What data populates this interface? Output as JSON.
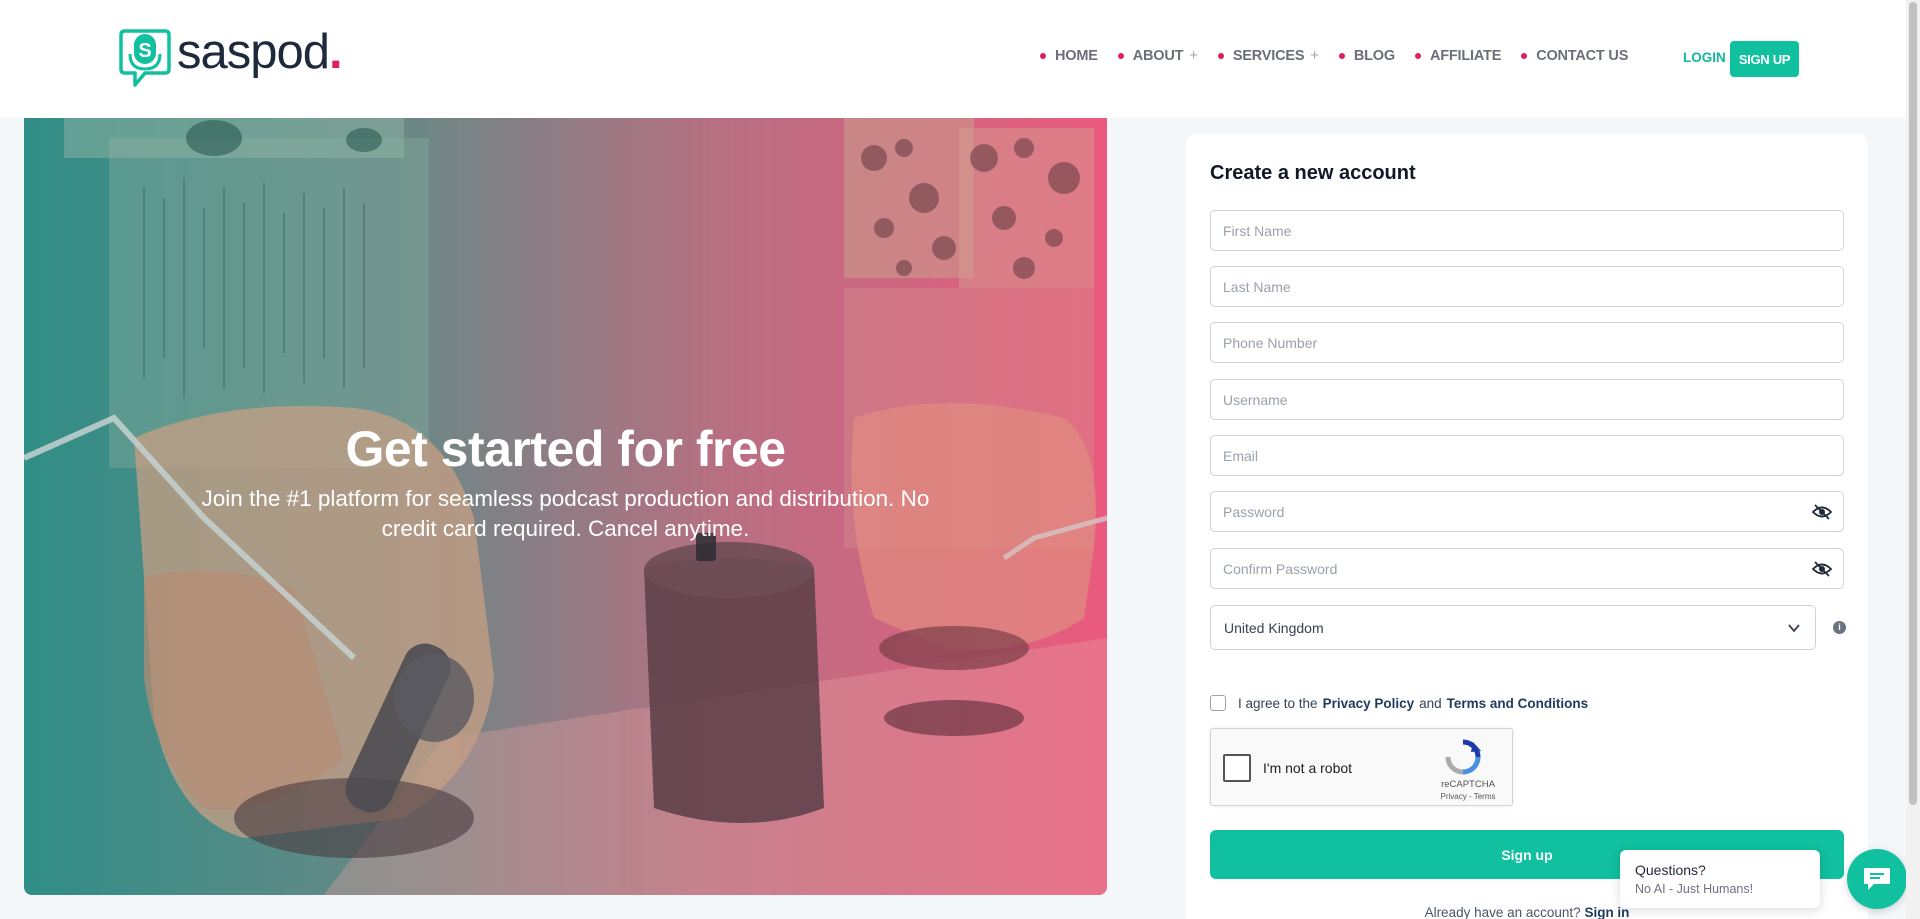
{
  "header": {
    "logo_text": "saspod",
    "logo_dot": ".",
    "nav": [
      {
        "label": "HOME",
        "has_submenu": false
      },
      {
        "label": "ABOUT",
        "has_submenu": true
      },
      {
        "label": "SERVICES",
        "has_submenu": true
      },
      {
        "label": "BLOG",
        "has_submenu": false
      },
      {
        "label": "AFFILIATE",
        "has_submenu": false
      },
      {
        "label": "CONTACT US",
        "has_submenu": false
      }
    ],
    "submenu_glyph": "+",
    "login_label": "LOGIN",
    "signup_label": "SIGN UP"
  },
  "hero": {
    "title": "Get started for free",
    "subtitle": "Join the #1 platform for seamless podcast production and distribution. No credit card required. Cancel anytime."
  },
  "form": {
    "title": "Create a new account",
    "fields": {
      "first_name": {
        "placeholder": "First Name",
        "value": ""
      },
      "last_name": {
        "placeholder": "Last Name",
        "value": ""
      },
      "phone": {
        "placeholder": "Phone Number",
        "value": ""
      },
      "username": {
        "placeholder": "Username",
        "value": ""
      },
      "email": {
        "placeholder": "Email",
        "value": ""
      },
      "password": {
        "placeholder": "Password",
        "value": ""
      },
      "confirm_password": {
        "placeholder": "Confirm Password",
        "value": ""
      }
    },
    "country": {
      "selected": "United Kingdom"
    },
    "info_glyph": "i",
    "agree": {
      "prefix": "I agree to the",
      "privacy": "Privacy Policy",
      "conj": "and",
      "terms": "Terms and Conditions",
      "checked": false
    },
    "recaptcha": {
      "label": "I'm not a robot",
      "brand": "reCAPTCHA",
      "links": "Privacy - Terms"
    },
    "submit_label": "Sign up",
    "signin_prompt": "Already have an account?",
    "signin_link": "Sign in"
  },
  "chat": {
    "title": "Questions?",
    "subtitle": "No AI - Just Humans!"
  },
  "colors": {
    "brand": "#10c09f",
    "accent": "#e11d63",
    "link": "#1e3a5f"
  }
}
